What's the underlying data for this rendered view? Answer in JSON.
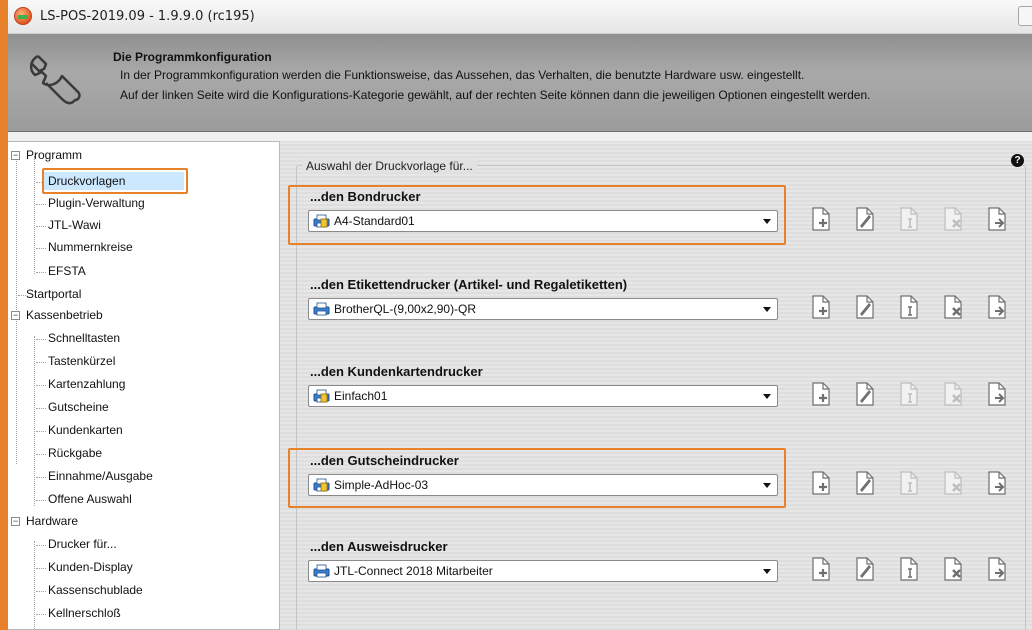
{
  "window": {
    "title": "LS-POS-2019.09 - 1.9.9.0 (rc195)"
  },
  "header": {
    "title": "Die Programmkonfiguration",
    "line1": "In der Programmkonfiguration werden die Funktionsweise, das Aussehen, das Verhalten, die benutzte Hardware usw. eingestellt.",
    "line2": "Auf der linken Seite wird die Konfigurations-Kategorie gewählt, auf der rechten Seite können dann die jeweiligen Optionen eingestellt werden."
  },
  "tree": {
    "items": [
      {
        "label": "Programm"
      },
      {
        "label": "Druckvorlagen"
      },
      {
        "label": "Plugin-Verwaltung"
      },
      {
        "label": "JTL-Wawi"
      },
      {
        "label": "Nummernkreise"
      },
      {
        "label": "EFSTA"
      },
      {
        "label": "Startportal"
      },
      {
        "label": "Kassenbetrieb"
      },
      {
        "label": "Schnelltasten"
      },
      {
        "label": "Tastenkürzel"
      },
      {
        "label": "Kartenzahlung"
      },
      {
        "label": "Gutscheine"
      },
      {
        "label": "Kundenkarten"
      },
      {
        "label": "Rückgabe"
      },
      {
        "label": "Einnahme/Ausgabe"
      },
      {
        "label": "Offene Auswahl"
      },
      {
        "label": "Hardware"
      },
      {
        "label": "Drucker für..."
      },
      {
        "label": "Kunden-Display"
      },
      {
        "label": "Kassenschublade"
      },
      {
        "label": "Kellnerschloß"
      }
    ],
    "selected": "Druckvorlagen"
  },
  "content": {
    "group_label": "Auswahl der Druckvorlage für...",
    "printers": [
      {
        "label": "...den Bondrucker",
        "value": "A4-Standard01"
      },
      {
        "label": "...den Etikettendrucker (Artikel- und Regaletiketten)",
        "value": "BrotherQL-(9,00x2,90)-QR"
      },
      {
        "label": "...den Kundenkartendrucker",
        "value": "Einfach01"
      },
      {
        "label": "...den Gutscheindrucker",
        "value": "Simple-AdHoc-03"
      },
      {
        "label": "...den Ausweisdrucker",
        "value": "JTL-Connect 2018 Mitarbeiter"
      }
    ]
  },
  "colors": {
    "highlight": "#e8822a",
    "selection": "#cce8ff"
  },
  "icons": [
    "app-icon",
    "wrench-icon",
    "help-icon",
    "printer-icon",
    "new-document-icon",
    "edit-document-icon",
    "rename-document-icon",
    "delete-document-icon",
    "export-document-icon"
  ]
}
